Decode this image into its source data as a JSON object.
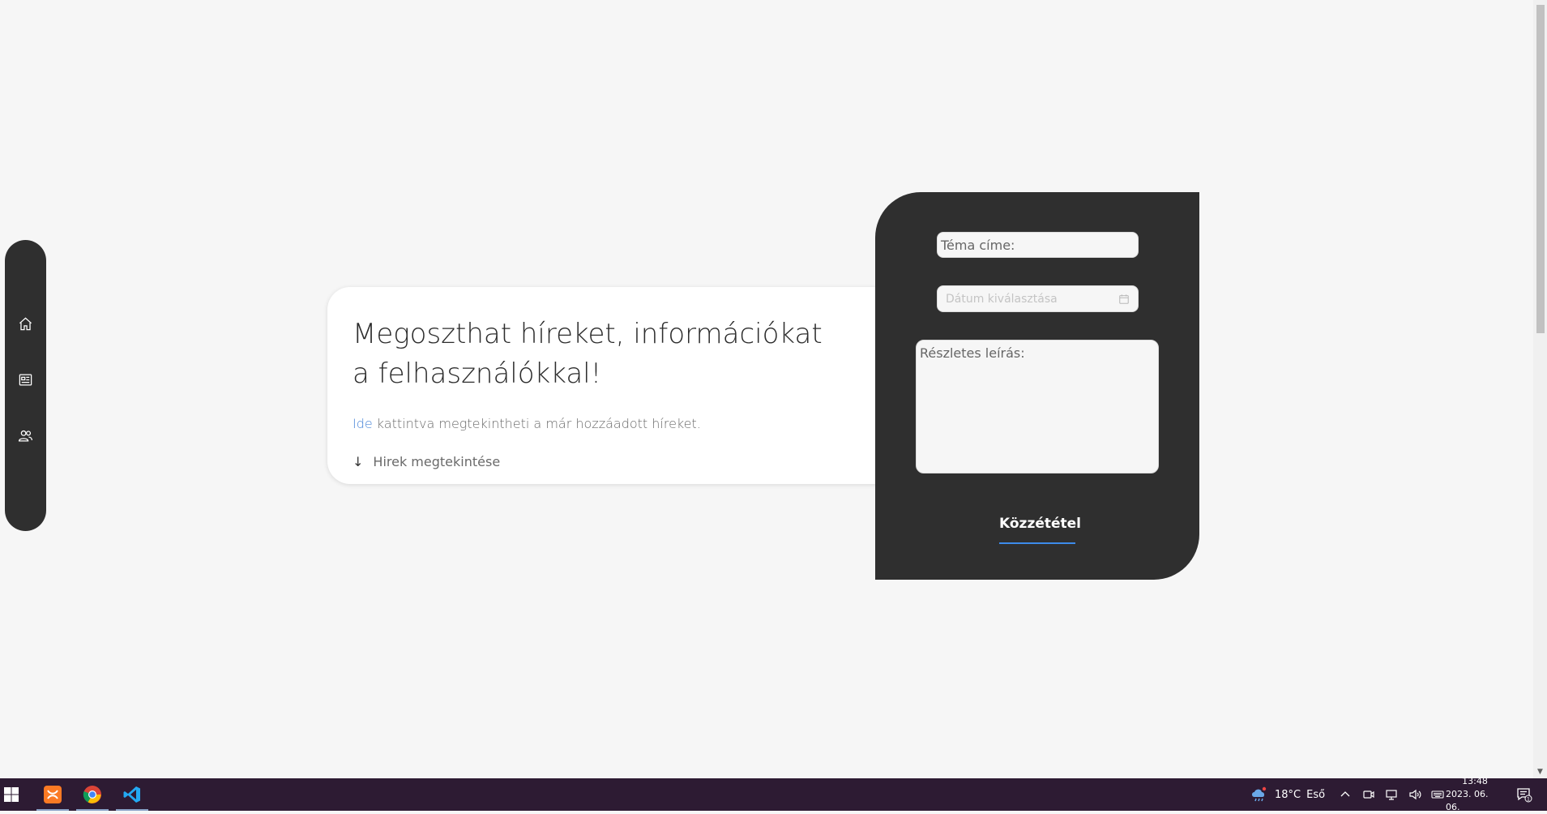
{
  "sidebar": {
    "items": [
      {
        "icon": "home-icon"
      },
      {
        "icon": "news-icon"
      },
      {
        "icon": "users-icon"
      }
    ]
  },
  "info_card": {
    "title": "Megoszthat híreket, információkat a felhasználókkal!",
    "link_text": "Ide",
    "text_rest": " kattintva megtekintheti a már hozzáadott híreket.",
    "news_arrow": "↓",
    "news_label": "Hirek megtekintése"
  },
  "form": {
    "title_placeholder": "Téma címe:",
    "date_placeholder": "Dátum kiválasztása",
    "desc_placeholder": "Részletes leírás:",
    "submit_label": "Közzététel"
  },
  "taskbar": {
    "apps": [
      "XAMPP",
      "Google Chrome",
      "Visual Studio Code"
    ],
    "weather_temp": "18°C",
    "weather_desc": "Eső",
    "time": "13:48",
    "date": "2023. 06. 06.",
    "notification_count": "1"
  },
  "colors": {
    "background": "#f6f6f6",
    "panel_dark": "#2f2f2f",
    "link": "#4a86d8",
    "submit_underline": "#3d8bea",
    "taskbar": "#2d1b33"
  }
}
